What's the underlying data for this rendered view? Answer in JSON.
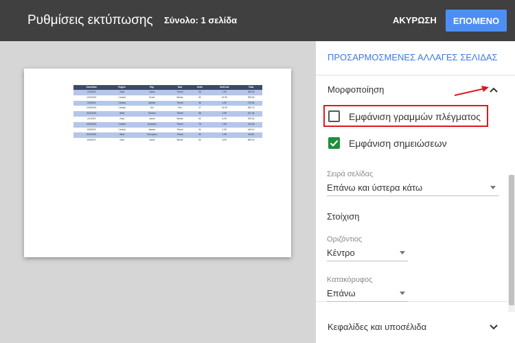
{
  "header": {
    "title": "Ρυθμίσεις εκτύπωσης",
    "total_label": "Σύνολο: 1 σελίδα",
    "cancel_label": "ΑΚΥΡΩΣΗ",
    "next_label": "ΕΠΟΜΕΝΟ",
    "next_color": "#4d8ef5"
  },
  "panel": {
    "custom_page_breaks": "ΠΡΟΣΑΡΜΟΣΜΕΝΕΣ ΑΛΛΑΓΕΣ ΣΕΛΙΔΑΣ",
    "formatting_title": "Μορφοποίηση",
    "show_gridlines": {
      "label": "Εμφάνιση γραμμών πλέγματος",
      "checked": false
    },
    "show_notes": {
      "label": "Εμφάνιση σημειώσεων",
      "checked": true
    },
    "page_order": {
      "label": "Σειρά σελίδας",
      "value": "Επάνω και ύστερα κάτω"
    },
    "alignment_title": "Στοίχιση",
    "horizontal": {
      "label": "Οριζόντιος",
      "value": "Κέντρο"
    },
    "vertical": {
      "label": "Κατακόρυφος",
      "value": "Επάνω"
    },
    "headers_footers": "Κεφαλίδες και υποσέλιδα",
    "accent_color": "#3b78e7",
    "checkbox_color": "#1e8e3e",
    "highlight_color": "#e0161c"
  },
  "preview": {
    "headers": [
      "OrderDate",
      "Region",
      "Rep",
      "Item",
      "Units",
      "UnitCost",
      "Total"
    ],
    "rows": [
      [
        "1/6/2019",
        "East",
        "Jones",
        "Pencil",
        "95",
        "1.99",
        "189.05"
      ],
      [
        "1/23/2019",
        "Central",
        "Kivell",
        "Binder",
        "50",
        "19.99",
        "999.50"
      ],
      [
        "2/9/2019",
        "Central",
        "Jardine",
        "Pencil",
        "36",
        "4.99",
        "179.64"
      ],
      [
        "2/26/2019",
        "Central",
        "Gill",
        "Pen",
        "27",
        "19.99",
        "539.73"
      ],
      [
        "3/15/2019",
        "West",
        "Sorvino",
        "Pencil",
        "56",
        "2.99",
        "167.44"
      ],
      [
        "4/1/2019",
        "East",
        "Jones",
        "Binder",
        "60",
        "4.99",
        "299.40"
      ],
      [
        "4/18/2019",
        "Central",
        "Andrews",
        "Pencil",
        "75",
        "1.99",
        "149.25"
      ],
      [
        "5/5/2019",
        "Central",
        "Jardine",
        "Pencil",
        "90",
        "4.99",
        "449.10"
      ],
      [
        "5/22/2019",
        "West",
        "Thompson",
        "Pencil",
        "32",
        "1.99",
        "63.68"
      ],
      [
        "6/8/2019",
        "East",
        "Jones",
        "Binder",
        "60",
        "8.99",
        "539.40"
      ]
    ],
    "header_color": "#3b4a67",
    "band_color": "#b5c6e8"
  }
}
